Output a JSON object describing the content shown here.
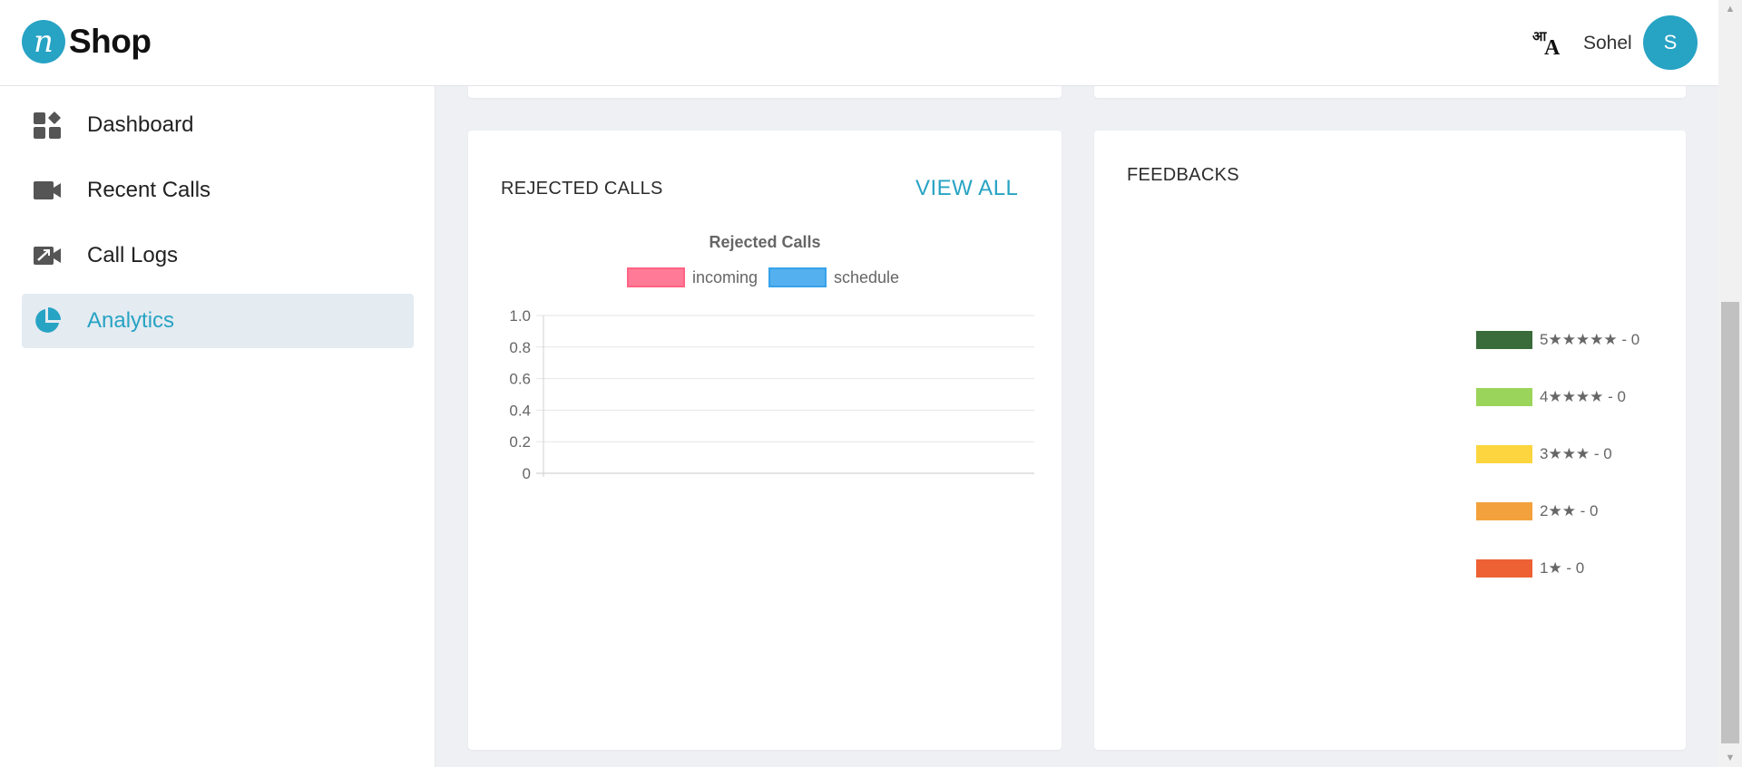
{
  "header": {
    "logo_mark": "n",
    "logo_text": "Shop",
    "lang_glyph_hindi": "आ",
    "lang_glyph_latin": "A",
    "user_name": "Sohel",
    "avatar_initial": "S"
  },
  "sidebar": {
    "items": [
      {
        "label": "Dashboard",
        "icon": "dashboard-icon",
        "active": false
      },
      {
        "label": "Recent Calls",
        "icon": "video-camera-icon",
        "active": false
      },
      {
        "label": "Call Logs",
        "icon": "call-log-icon",
        "active": false
      },
      {
        "label": "Analytics",
        "icon": "pie-chart-icon",
        "active": true
      }
    ]
  },
  "rejected_calls_card": {
    "title": "REJECTED CALLS",
    "view_all_label": "VIEW ALL"
  },
  "feedbacks_card": {
    "title": "FEEDBACKS",
    "legend": [
      {
        "label": "5★★★★★ - 0",
        "color": "#3a6b3b",
        "count": 0
      },
      {
        "label": "4★★★★ - 0",
        "color": "#9bd45a",
        "count": 0
      },
      {
        "label": "3★★★ - 0",
        "color": "#fcd53f",
        "count": 0
      },
      {
        "label": "2★★ - 0",
        "color": "#f3a13c",
        "count": 0
      },
      {
        "label": "1★ - 0",
        "color": "#ed6134",
        "count": 0
      }
    ]
  },
  "colors": {
    "accent": "#27a3c4",
    "incoming": "#ff6384",
    "schedule": "#36a2eb"
  },
  "chart_data": {
    "type": "bar",
    "title": "Rejected Calls",
    "xlabel": "",
    "ylabel": "",
    "categories": [],
    "series": [
      {
        "name": "incoming",
        "values": [],
        "color": "#ff6384"
      },
      {
        "name": "schedule",
        "values": [],
        "color": "#36a2eb"
      }
    ],
    "ylim": [
      0,
      1.0
    ],
    "y_ticks": [
      "1.0",
      "0.8",
      "0.6",
      "0.4",
      "0.2",
      "0"
    ],
    "grid": true,
    "legend_position": "top"
  }
}
